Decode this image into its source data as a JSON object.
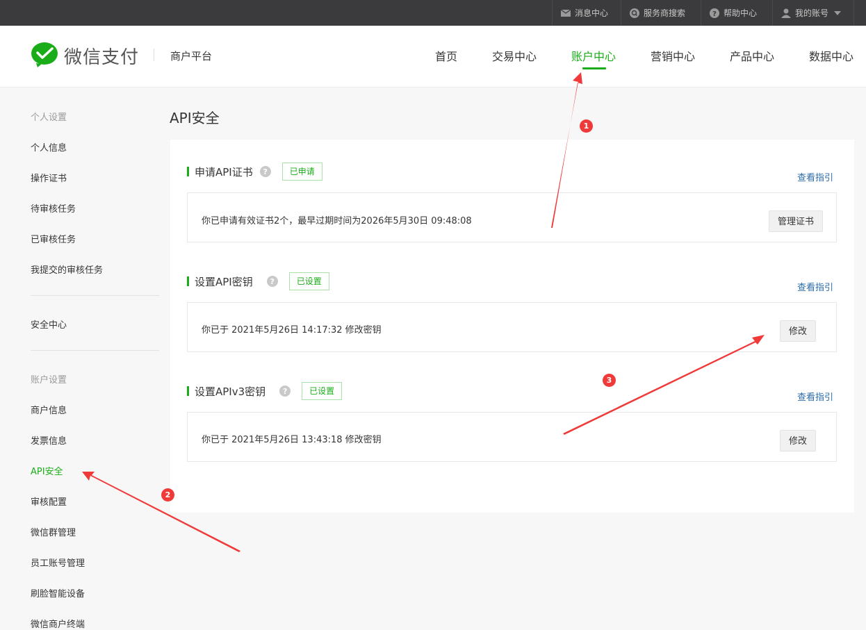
{
  "topbar": {
    "items": [
      {
        "label": "消息中心",
        "icon": "mail-icon"
      },
      {
        "label": "服务商搜索",
        "icon": "search-icon"
      },
      {
        "label": "帮助中心",
        "icon": "help-icon"
      },
      {
        "label": "我的账号",
        "icon": "user-icon"
      }
    ]
  },
  "header": {
    "logo_text": "微信支付",
    "platform": "商户平台",
    "nav": [
      {
        "label": "首页"
      },
      {
        "label": "交易中心"
      },
      {
        "label": "账户中心",
        "active": true
      },
      {
        "label": "营销中心"
      },
      {
        "label": "产品中心"
      },
      {
        "label": "数据中心"
      }
    ]
  },
  "sidebar": {
    "group1": "个人设置",
    "group1_items": [
      "个人信息",
      "操作证书",
      "待审核任务",
      "已审核任务",
      "我提交的审核任务"
    ],
    "security": "安全中心",
    "group2": "账户设置",
    "group2_items": [
      "商户信息",
      "发票信息",
      "API安全",
      "审核配置",
      "微信群管理",
      "员工账号管理",
      "刷脸智能设备",
      "微信商户终端"
    ]
  },
  "main": {
    "title": "API安全",
    "sections": [
      {
        "title": "申请API证书",
        "badge": "已申请",
        "guide": "查看指引",
        "text": "你已申请有效证书2个，最早过期时间为2026年5月30日 09:48:08",
        "button": "管理证书"
      },
      {
        "title": "设置API密钥",
        "badge": "已设置",
        "guide": "查看指引",
        "text": "你已于 2021年5月26日 14:17:32 修改密钥",
        "button": "修改"
      },
      {
        "title": "设置APIv3密钥",
        "badge": "已设置",
        "guide": "查看指引",
        "text": "你已于 2021年5月26日 13:43:18 修改密钥",
        "button": "修改"
      }
    ]
  },
  "annotations": {
    "n1": "1",
    "n2": "2",
    "n3": "3"
  },
  "colors": {
    "accent": "#1aad19",
    "topbar": "#3b3b3d",
    "annotation": "#f03a3a"
  }
}
